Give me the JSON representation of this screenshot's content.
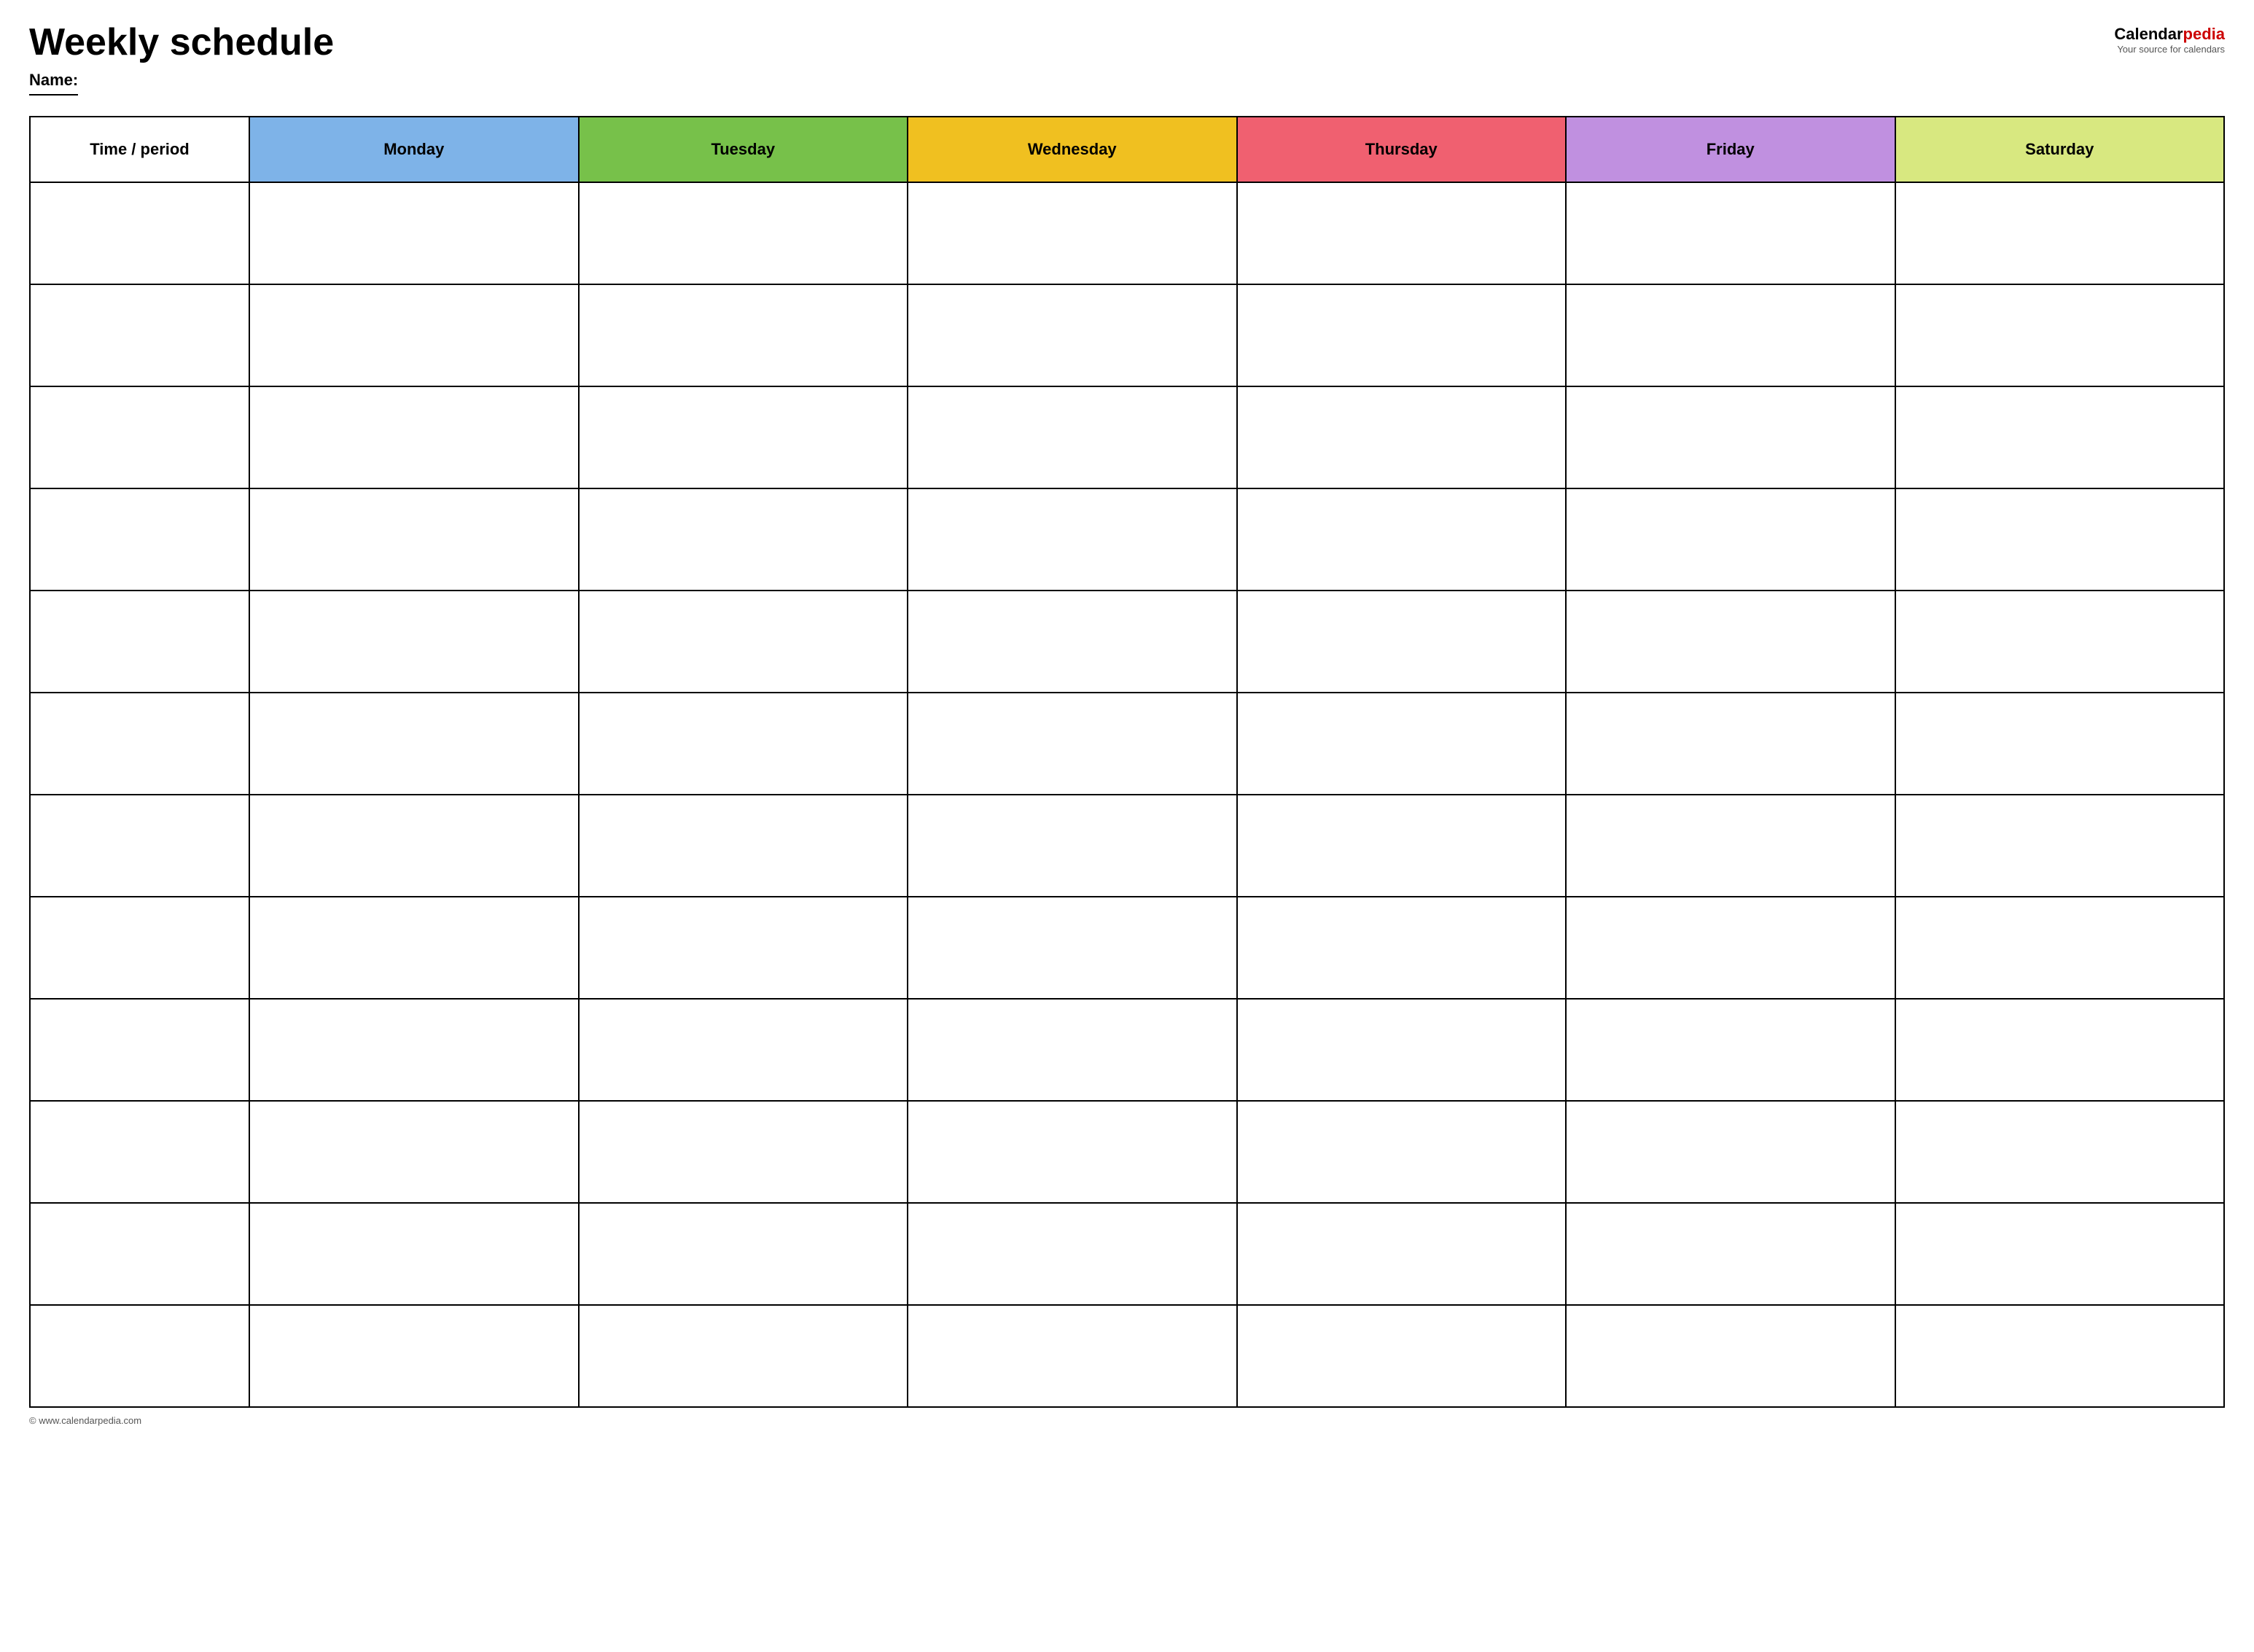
{
  "header": {
    "title": "Weekly schedule",
    "name_label": "Name:",
    "logo_calendar": "Calendar",
    "logo_pedia": "pedia",
    "logo_tagline": "Your source for calendars"
  },
  "table": {
    "columns": [
      {
        "key": "time",
        "label": "Time / period",
        "class": "header-time col-time"
      },
      {
        "key": "monday",
        "label": "Monday",
        "class": "header-monday col-day"
      },
      {
        "key": "tuesday",
        "label": "Tuesday",
        "class": "header-tuesday col-day"
      },
      {
        "key": "wednesday",
        "label": "Wednesday",
        "class": "header-wednesday col-day"
      },
      {
        "key": "thursday",
        "label": "Thursday",
        "class": "header-thursday col-day"
      },
      {
        "key": "friday",
        "label": "Friday",
        "class": "header-friday col-day"
      },
      {
        "key": "saturday",
        "label": "Saturday",
        "class": "header-saturday col-day"
      }
    ],
    "row_count": 12
  },
  "footer": {
    "url": "© www.calendarpedia.com"
  }
}
